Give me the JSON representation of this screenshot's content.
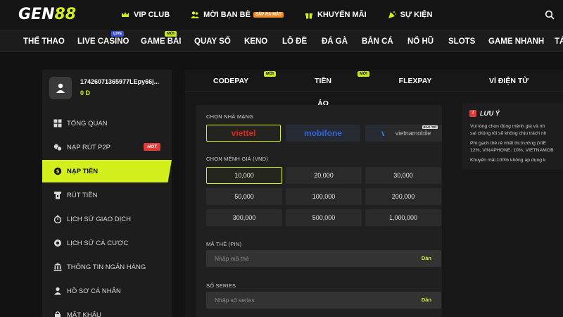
{
  "logo": {
    "part1": "GEN",
    "part2": "88"
  },
  "top_links": [
    "VIP CLUB",
    "MỜI BẠN BÈ",
    "KHUYẾN MÃI",
    "SỰ KIỆN"
  ],
  "top_badge": "SẮP RA MẮT",
  "nav": [
    "THỂ THAO",
    "LIVE CASINO",
    "GAME BÀI",
    "QUAY SỐ",
    "KENO",
    "LÔ ĐỀ",
    "ĐÁ GÀ",
    "BẮN CÁ",
    "NỔ HŨ",
    "SLOTS",
    "GAME NHANH",
    "TÁ"
  ],
  "nav_badges": {
    "live": "LIVE",
    "new": "MỚI"
  },
  "user": {
    "name": "17426071365977LEpy66j...",
    "balance": "0 D"
  },
  "menu": [
    "TỔNG QUAN",
    "NẠP RÚT P2P",
    "NẠP TIỀN",
    "RÚT TIỀN",
    "LỊCH SỬ GIAO DỊCH",
    "LỊCH SỬ CÁ CƯỢC",
    "THÔNG TIN NGÂN HÀNG",
    "HỒ SƠ CÁ NHÂN",
    "MẬT KHẨU"
  ],
  "hot_badge": "HOT",
  "tabs": [
    "CODEPAY",
    "TIỀN ẢO",
    "FLEXPAY",
    "VÍ ĐIỆN TỬ"
  ],
  "tab_badge": "MỚI",
  "form": {
    "carrier_label": "CHỌN NHÀ MẠNG",
    "carriers": [
      "viettel",
      "mobifone",
      "vinaphone",
      "vietnamobile"
    ],
    "maintenance_badge": "BẢO TRÌ",
    "amount_label": "CHỌN MỆNH GIÁ (VND)",
    "amounts": [
      "10,000",
      "20,000",
      "30,000",
      "50,000",
      "100,000",
      "200,000",
      "300,000",
      "500,000",
      "1,000,000"
    ],
    "pin_label": "MÃ THẺ (PIN)",
    "pin_placeholder": "Nhập mã thẻ",
    "serial_label": "SỐ SERIES",
    "serial_placeholder": "Nhập số series",
    "paste_label": "Dán"
  },
  "notice": {
    "title": "LƯU Ý",
    "lines": [
      "Vui lòng chọn đúng mệnh giá và nh",
      "sai chúng tôi sẽ không chịu trách nh",
      "Phí gạch thẻ rẻ nhất thị trường (VIE",
      "12%, VINAPHONE: 10%, VIETNAMOB",
      "Khuyến mãi 100% không áp dụng k"
    ]
  },
  "colors": {
    "accent": "#d4f01c",
    "hot": "#e23b3b",
    "live": "#3b4fd8",
    "viettel": "#e0241b"
  }
}
